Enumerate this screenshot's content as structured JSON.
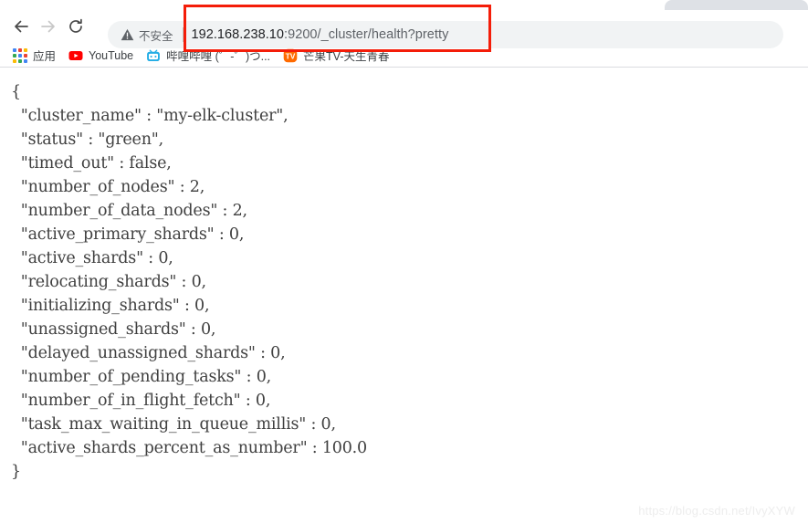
{
  "browser": {
    "tab_strip": {
      "partial_tab_name": "inactive-background-tab"
    },
    "toolbar": {
      "back_label": "←",
      "forward_label": "→",
      "reload_label": "⟳",
      "security_label": "不安全",
      "warning_icon": "warning-triangle-icon",
      "url": {
        "host": "192.168.238.10",
        "rest": ":9200/_cluster/health?pretty",
        "full": "192.168.238.10:9200/_cluster/health?pretty"
      }
    },
    "bookmarks": [
      {
        "label": "应用",
        "icon": "apps-grid-icon"
      },
      {
        "label": "YouTube",
        "icon": "youtube-icon"
      },
      {
        "label": "哔哩哔哩 (゜-゜)つ...",
        "icon": "bilibili-icon"
      },
      {
        "label": "芒果TV-天生青春",
        "icon": "mangotv-icon"
      }
    ]
  },
  "annotation": {
    "name": "red-highlight-box",
    "color": "#f41d09",
    "target": "address-bar"
  },
  "page": {
    "watermark": "https://blog.csdn.net/IvyXYW",
    "response_body": "{\n  \"cluster_name\" : \"my-elk-cluster\",\n  \"status\" : \"green\",\n  \"timed_out\" : false,\n  \"number_of_nodes\" : 2,\n  \"number_of_data_nodes\" : 2,\n  \"active_primary_shards\" : 0,\n  \"active_shards\" : 0,\n  \"relocating_shards\" : 0,\n  \"initializing_shards\" : 0,\n  \"unassigned_shards\" : 0,\n  \"delayed_unassigned_shards\" : 0,\n  \"number_of_pending_tasks\" : 0,\n  \"number_of_in_flight_fetch\" : 0,\n  \"task_max_waiting_in_queue_millis\" : 0,\n  \"active_shards_percent_as_number\" : 100.0\n}",
    "json_fields": {
      "cluster_name": "my-elk-cluster",
      "status": "green",
      "timed_out": "false",
      "number_of_nodes": "2",
      "number_of_data_nodes": "2",
      "active_primary_shards": "0",
      "active_shards": "0",
      "relocating_shards": "0",
      "initializing_shards": "0",
      "unassigned_shards": "0",
      "delayed_unassigned_shards": "0",
      "number_of_pending_tasks": "0",
      "number_of_in_flight_fetch": "0",
      "task_max_waiting_in_queue_millis": "0",
      "active_shards_percent_as_number": "100.0"
    }
  }
}
